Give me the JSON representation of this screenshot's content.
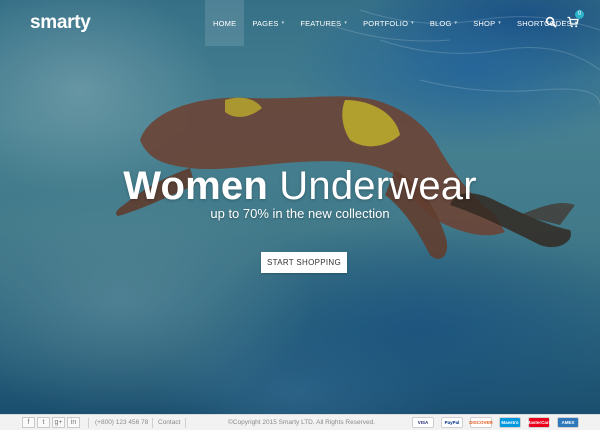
{
  "brand": {
    "logo_text": "smarty"
  },
  "nav": {
    "items": [
      {
        "label": "HOME",
        "active": true,
        "has_dropdown": false
      },
      {
        "label": "PAGES",
        "active": false,
        "has_dropdown": true
      },
      {
        "label": "FEATURES",
        "active": false,
        "has_dropdown": true
      },
      {
        "label": "PORTFOLIO",
        "active": false,
        "has_dropdown": true
      },
      {
        "label": "BLOG",
        "active": false,
        "has_dropdown": true
      },
      {
        "label": "SHOP",
        "active": false,
        "has_dropdown": true
      },
      {
        "label": "SHORTCODES",
        "active": false,
        "has_dropdown": true
      }
    ],
    "search_icon": "search-icon",
    "cart_icon": "cart-icon",
    "cart_count": "0"
  },
  "hero": {
    "headline_bold": "Women",
    "headline_light": "Underwear",
    "subheadline": "up to 70% in the new collection",
    "cta_label": "START SHOPPING"
  },
  "footer": {
    "social": [
      {
        "icon": "facebook-icon",
        "glyph": "f"
      },
      {
        "icon": "twitter-icon",
        "glyph": "t"
      },
      {
        "icon": "google-plus-icon",
        "glyph": "g+"
      },
      {
        "icon": "linkedin-icon",
        "glyph": "in"
      }
    ],
    "phone": "(+800) 123 456 78",
    "contact": "Contact",
    "copyright": "©Copyright 2015 Smarty LTD. All Rights Reserved.",
    "payments": [
      {
        "name": "VISA",
        "color": "#1a1f71",
        "bg": "#ffffff"
      },
      {
        "name": "PayPal",
        "color": "#003087",
        "bg": "#ffffff"
      },
      {
        "name": "DISCOVER",
        "color": "#e55c20",
        "bg": "#ffffff"
      },
      {
        "name": "Maestro",
        "color": "#ffffff",
        "bg": "#0099df"
      },
      {
        "name": "MasterCard",
        "color": "#ffffff",
        "bg": "#eb001b"
      },
      {
        "name": "AMEX",
        "color": "#ffffff",
        "bg": "#2e77bb"
      }
    ]
  },
  "colors": {
    "accent": "#2bb3c9",
    "hero_overlay": "#0d3550",
    "footer_bg": "#f2f2f2"
  }
}
